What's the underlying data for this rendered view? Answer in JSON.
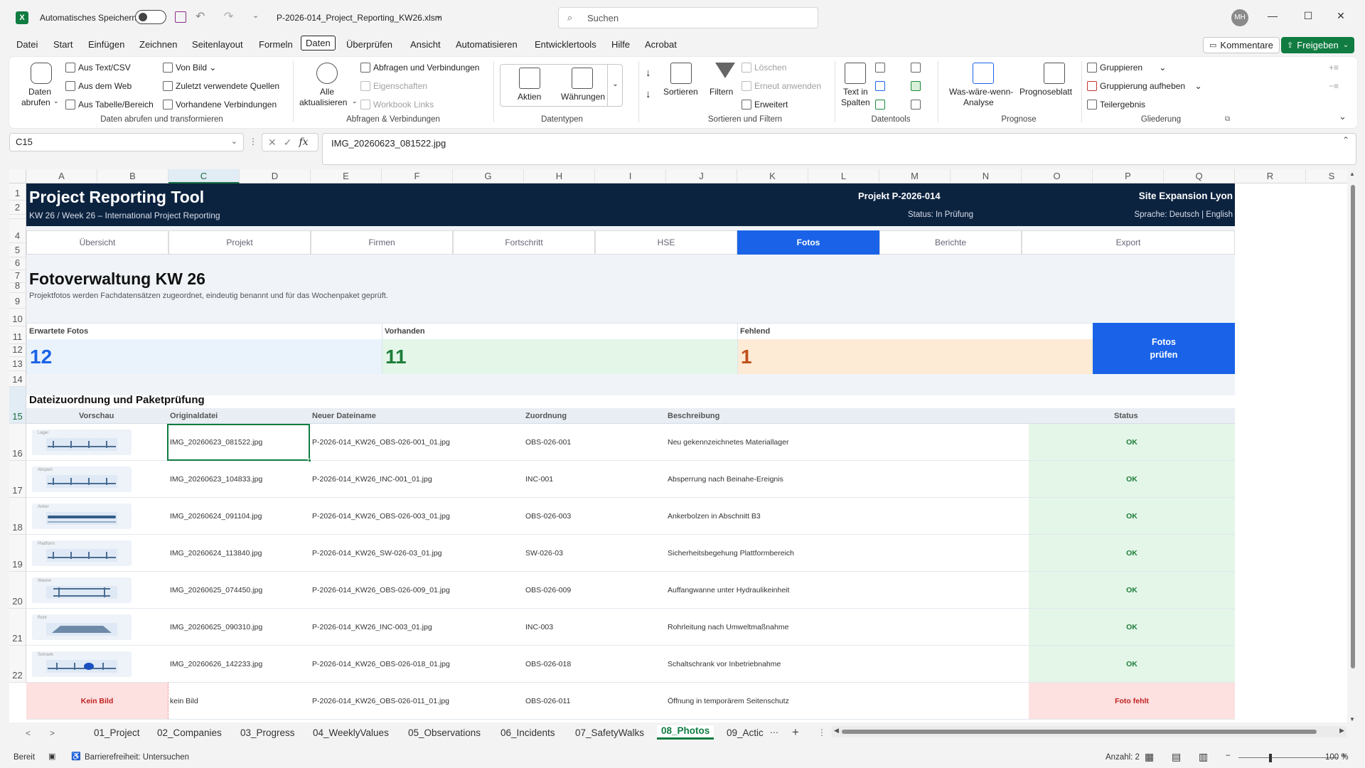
{
  "titlebar": {
    "autosave_label": "Automatisches Speichern",
    "filename": "P-2026-014_Project_Reporting_KW26.xlsm",
    "search_placeholder": "Suchen",
    "user_initials": "MH"
  },
  "menu": {
    "items": [
      "Datei",
      "Start",
      "Einfügen",
      "Zeichnen",
      "Seitenlayout",
      "Formeln",
      "Daten",
      "Überprüfen",
      "Ansicht",
      "Automatisieren",
      "Entwicklertools",
      "Hilfe",
      "Acrobat"
    ],
    "active": "Daten",
    "comments": "Kommentare",
    "share": "Freigeben"
  },
  "ribbon": {
    "get_data": "Daten",
    "get_data2": "abrufen",
    "from_text": "Aus Text/CSV",
    "from_web": "Aus dem Web",
    "from_table": "Aus Tabelle/Bereich",
    "from_picture": "Von Bild",
    "recent_sources": "Zuletzt verwendete Quellen",
    "existing_connections": "Vorhandene Verbindungen",
    "group1": "Daten abrufen und transformieren",
    "refresh_all": "Alle",
    "refresh_all2": "aktualisieren",
    "queries": "Abfragen und Verbindungen",
    "properties": "Eigenschaften",
    "workbook_links": "Workbook Links",
    "group2": "Abfragen & Verbindungen",
    "stocks": "Aktien",
    "currencies": "Währungen",
    "group3": "Datentypen",
    "sort": "Sortieren",
    "filter": "Filtern",
    "clear": "Löschen",
    "reapply": "Erneut anwenden",
    "advanced": "Erweitert",
    "group4": "Sortieren und Filtern",
    "text_to_columns": "Text in",
    "text_to_columns2": "Spalten",
    "group5": "Datentools",
    "whatif": "Was-wäre-wenn-",
    "whatif2": "Analyse",
    "forecast": "Prognoseblatt",
    "group6": "Prognose",
    "group_btn": "Gruppieren",
    "ungroup": "Gruppierung aufheben",
    "subtotal": "Teilergebnis",
    "group7": "Gliederung"
  },
  "formula_bar": {
    "name_box": "C15",
    "formula": "IMG_20260623_081522.jpg"
  },
  "columns": [
    "A",
    "B",
    "C",
    "D",
    "E",
    "F",
    "G",
    "H",
    "I",
    "J",
    "K",
    "L",
    "M",
    "N",
    "O",
    "P",
    "Q",
    "R",
    "S"
  ],
  "rows": [
    "1",
    "2",
    "3",
    "4",
    "5",
    "6",
    "7",
    "8",
    "9",
    "10",
    "11",
    "12",
    "13",
    "14",
    "15",
    "16",
    "17",
    "18",
    "19",
    "20",
    "21",
    "22"
  ],
  "sheet": {
    "app_title": "Project Reporting Tool",
    "subtitle": "KW 26 / Week 26 – International Project Reporting",
    "project": "Projekt P-2026-014",
    "status": "Status: In Prüfung",
    "site": "Site Expansion Lyon",
    "language": "Sprache: Deutsch  |  English",
    "nav": [
      "Übersicht",
      "Projekt",
      "Firmen",
      "Fortschritt",
      "HSE",
      "Fotos",
      "Berichte",
      "Export"
    ],
    "nav_active": "Fotos",
    "heading": "Fotoverwaltung KW 26",
    "description": "Projektfotos werden Fachdatensätzen zugeordnet, eindeutig benannt und für das Wochenpaket geprüft.",
    "kpis": [
      {
        "label": "Erwartete Fotos",
        "value": "12",
        "color": "#1a63e8",
        "bg": "#eaf3fc"
      },
      {
        "label": "Vorhanden",
        "value": "11",
        "color": "#1e7d3a",
        "bg": "#e3f6e8"
      },
      {
        "label": "Fehlend",
        "value": "1",
        "color": "#c0501a",
        "bg": "#fdebd5"
      }
    ],
    "check_button": "Fotos prüfen",
    "check_button1": "Fotos",
    "check_button2": "prüfen",
    "table_title": "Dateizuordnung und Paketprüfung",
    "table_headers": [
      "Vorschau",
      "Originaldatei",
      "Neuer Dateiname",
      "Zuordnung",
      "Beschreibung",
      "Status"
    ],
    "table_rows": [
      {
        "thumb": "Lager",
        "orig": "IMG_20260623_081522.jpg",
        "new": "P-2026-014_KW26_OBS-026-001_01.jpg",
        "ref": "OBS-026-001",
        "desc": "Neu gekennzeichnetes Materiallager",
        "status": "OK"
      },
      {
        "thumb": "Absperr.",
        "orig": "IMG_20260623_104833.jpg",
        "new": "P-2026-014_KW26_INC-001_01.jpg",
        "ref": "INC-001",
        "desc": "Absperrung nach Beinahe-Ereignis",
        "status": "OK"
      },
      {
        "thumb": "Anker",
        "orig": "IMG_20260624_091104.jpg",
        "new": "P-2026-014_KW26_OBS-026-003_01.jpg",
        "ref": "OBS-026-003",
        "desc": "Ankerbolzen in Abschnitt B3",
        "status": "OK"
      },
      {
        "thumb": "Plattform",
        "orig": "IMG_20260624_113840.jpg",
        "new": "P-2026-014_KW26_SW-026-03_01.jpg",
        "ref": "SW-026-03",
        "desc": "Sicherheitsbegehung Plattformbereich",
        "status": "OK"
      },
      {
        "thumb": "Wanne",
        "orig": "IMG_20260625_074450.jpg",
        "new": "P-2026-014_KW26_OBS-026-009_01.jpg",
        "ref": "OBS-026-009",
        "desc": "Auffangwanne unter Hydraulikeinheit",
        "status": "OK"
      },
      {
        "thumb": "Rohr",
        "orig": "IMG_20260625_090310.jpg",
        "new": "P-2026-014_KW26_INC-003_01.jpg",
        "ref": "INC-003",
        "desc": "Rohrleitung nach Umweltmaßnahme",
        "status": "OK"
      },
      {
        "thumb": "Schrank",
        "orig": "IMG_20260626_142233.jpg",
        "new": "P-2026-014_KW26_OBS-026-018_01.jpg",
        "ref": "OBS-026-018",
        "desc": "Schaltschrank vor Inbetriebnahme",
        "status": "OK"
      },
      {
        "thumb": "Kein Bild",
        "orig": "kein Bild",
        "new": "P-2026-014_KW26_OBS-026-011_01.jpg",
        "ref": "OBS-026-011",
        "desc": "Öffnung in temporärem Seitenschutz",
        "status": "Foto fehlt"
      }
    ]
  },
  "sheet_tabs": [
    "01_Project",
    "02_Companies",
    "03_Progress",
    "04_WeeklyValues",
    "05_Observations",
    "06_Incidents",
    "07_SafetyWalks",
    "08_Photos",
    "09_Actic"
  ],
  "active_sheet": "08_Photos",
  "statusbar": {
    "ready": "Bereit",
    "accessibility": "Barrierefreiheit: Untersuchen",
    "count": "Anzahl: 2",
    "zoom": "100 %"
  },
  "colors": {
    "banner": "#0c2340",
    "accent": "#1a63e8",
    "excel_green": "#107c41",
    "ok_green": "#e3f6e8",
    "missing_red": "#fde0e0"
  }
}
